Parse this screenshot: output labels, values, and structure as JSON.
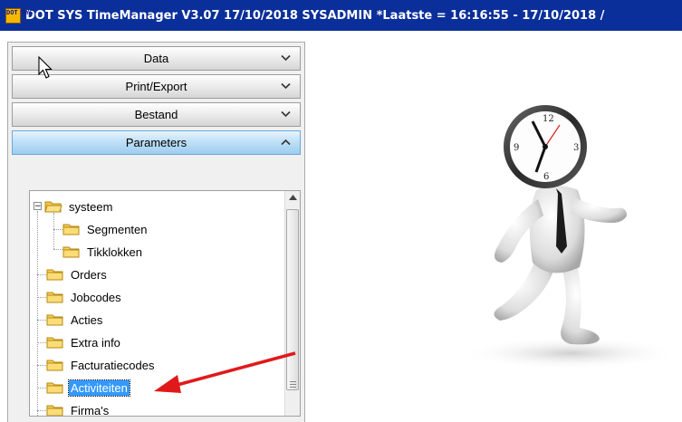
{
  "window": {
    "icon_text": "DOT SYS",
    "title": "DOT SYS TimeManager V3.07 17/10/2018 SYSADMIN  *Laatste = 16:16:55 - 17/10/2018 /"
  },
  "accordion": {
    "items": [
      {
        "label": "Data",
        "expanded": false
      },
      {
        "label": "Print/Export",
        "expanded": false
      },
      {
        "label": "Bestand",
        "expanded": false
      },
      {
        "label": "Parameters",
        "expanded": true
      }
    ],
    "chevron_down": "⌄",
    "chevron_up": "⌃"
  },
  "tree": {
    "items": [
      {
        "label": "systeem",
        "level": 0,
        "expanded": true
      },
      {
        "label": "Segmenten",
        "level": 1
      },
      {
        "label": "Tikklokken",
        "level": 1
      },
      {
        "label": "Orders",
        "level": 0
      },
      {
        "label": "Jobcodes",
        "level": 0
      },
      {
        "label": "Acties",
        "level": 0
      },
      {
        "label": "Extra info",
        "level": 0
      },
      {
        "label": "Facturatiecodes",
        "level": 0
      },
      {
        "label": "Activiteiten",
        "level": 0,
        "selected": true
      },
      {
        "label": "Firma's",
        "level": 0
      }
    ],
    "expander_symbol": "−"
  },
  "colors": {
    "titlebar": "#0b2f9a",
    "selection": "#3399ff",
    "annotation_arrow": "#e01a1a",
    "active_header": "#9dcdef"
  },
  "illustration": {
    "clock_numbers": [
      "12",
      "3",
      "6",
      "9"
    ]
  }
}
